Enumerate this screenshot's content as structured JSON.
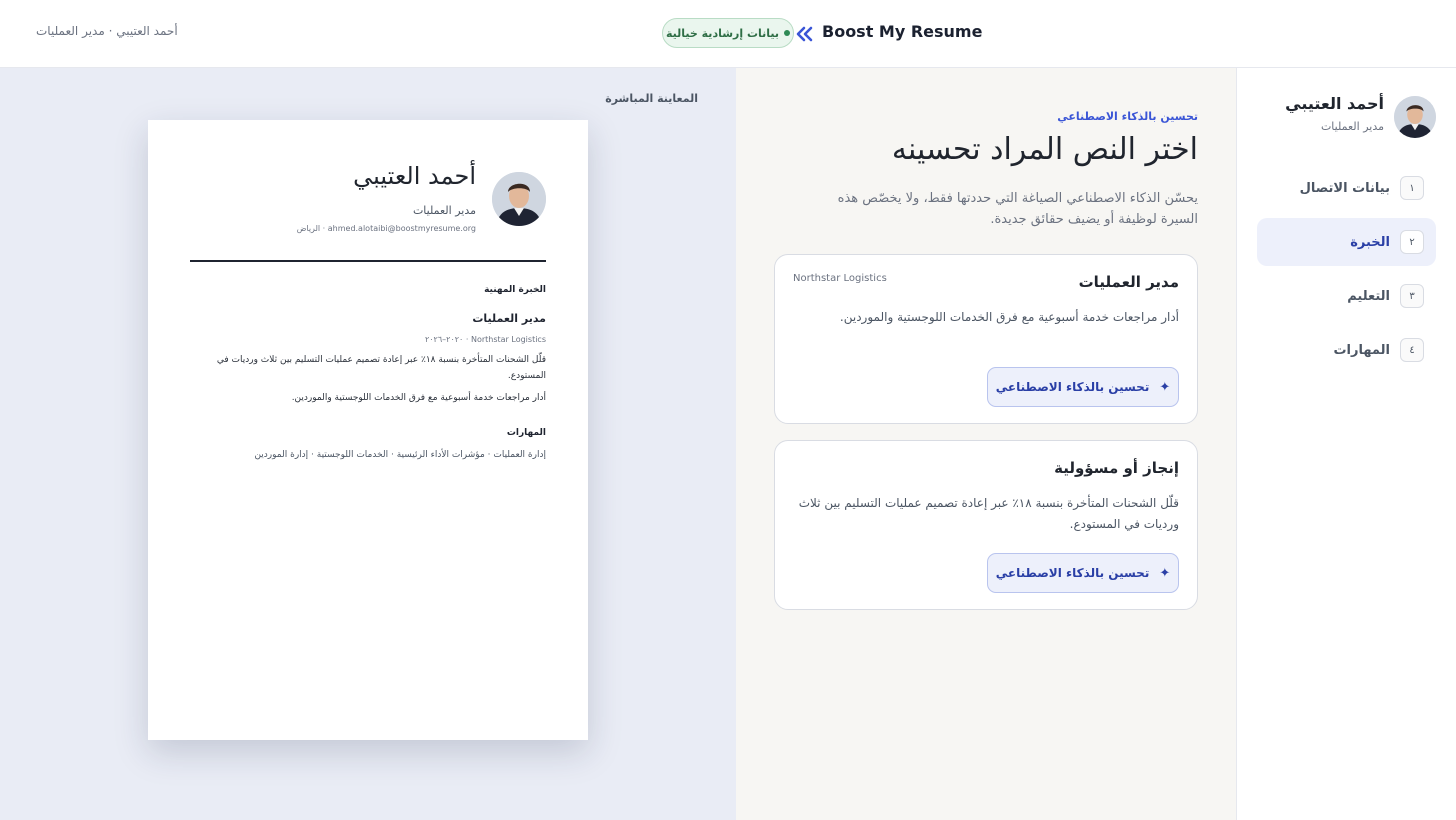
{
  "header": {
    "brand": "Boost My Resume",
    "demo_badge": "بيانات إرشادية خيالية",
    "user_line": "أحمد العتيبي · مدير العمليات"
  },
  "preview": {
    "label": "المعاينة المباشرة",
    "name": "أحمد العتيبي",
    "role": "مدير العمليات",
    "contact": "ahmed.alotaibi@boostmyresume.org · الرياض",
    "experience_heading": "الخبرة المهنية",
    "job_title": "مدير العمليات",
    "job_meta": "Northstar Logistics · ٢٠٢٠–٢٠٢٦",
    "bullet_1": "قلّل الشحنات المتأخرة بنسبة ١٨٪ عبر إعادة تصميم عمليات التسليم بين ثلاث ورديات في المستودع.",
    "bullet_2": "أدار مراجعات خدمة أسبوعية مع فرق الخدمات اللوجستية والموردين.",
    "skills_heading": "المهارات",
    "skills": "إدارة العمليات · مؤشرات الأداء الرئيسية · الخدمات اللوجستية · إدارة الموردين"
  },
  "editor": {
    "eyebrow": "تحسين بالذكاء الاصطناعي",
    "title": "اختر النص المراد تحسينه",
    "description": "يحسّن الذكاء الاصطناعي الصياغة التي حددتها فقط، ولا يخصّص هذه السيرة لوظيفة أو يضيف حقائق جديدة.",
    "cards": [
      {
        "title": "مدير العمليات",
        "company": "Northstar Logistics",
        "text": "أدار مراجعات خدمة أسبوعية مع فرق الخدمات اللوجستية والموردين.",
        "button": "تحسين بالذكاء الاصطناعي"
      },
      {
        "title": "إنجاز أو مسؤولية",
        "text": "قلّل الشحنات المتأخرة بنسبة ١٨٪ عبر إعادة تصميم عمليات التسليم بين ثلاث ورديات في المستودع.",
        "button": "تحسين بالذكاء الاصطناعي"
      }
    ]
  },
  "sidebar": {
    "name": "أحمد العتيبي",
    "role": "مدير العمليات",
    "steps": [
      {
        "num": "١",
        "label": "بيانات الاتصال"
      },
      {
        "num": "٢",
        "label": "الخبرة",
        "active": true
      },
      {
        "num": "٣",
        "label": "التعليم"
      },
      {
        "num": "٤",
        "label": "المهارات"
      }
    ]
  },
  "colors": {
    "accent": "#3a55d6",
    "accent_dark": "#2a3fa6",
    "badge_green": "#2f6e46",
    "preview_bg": "#e9ecf5",
    "editor_bg": "#f7f6f3"
  }
}
